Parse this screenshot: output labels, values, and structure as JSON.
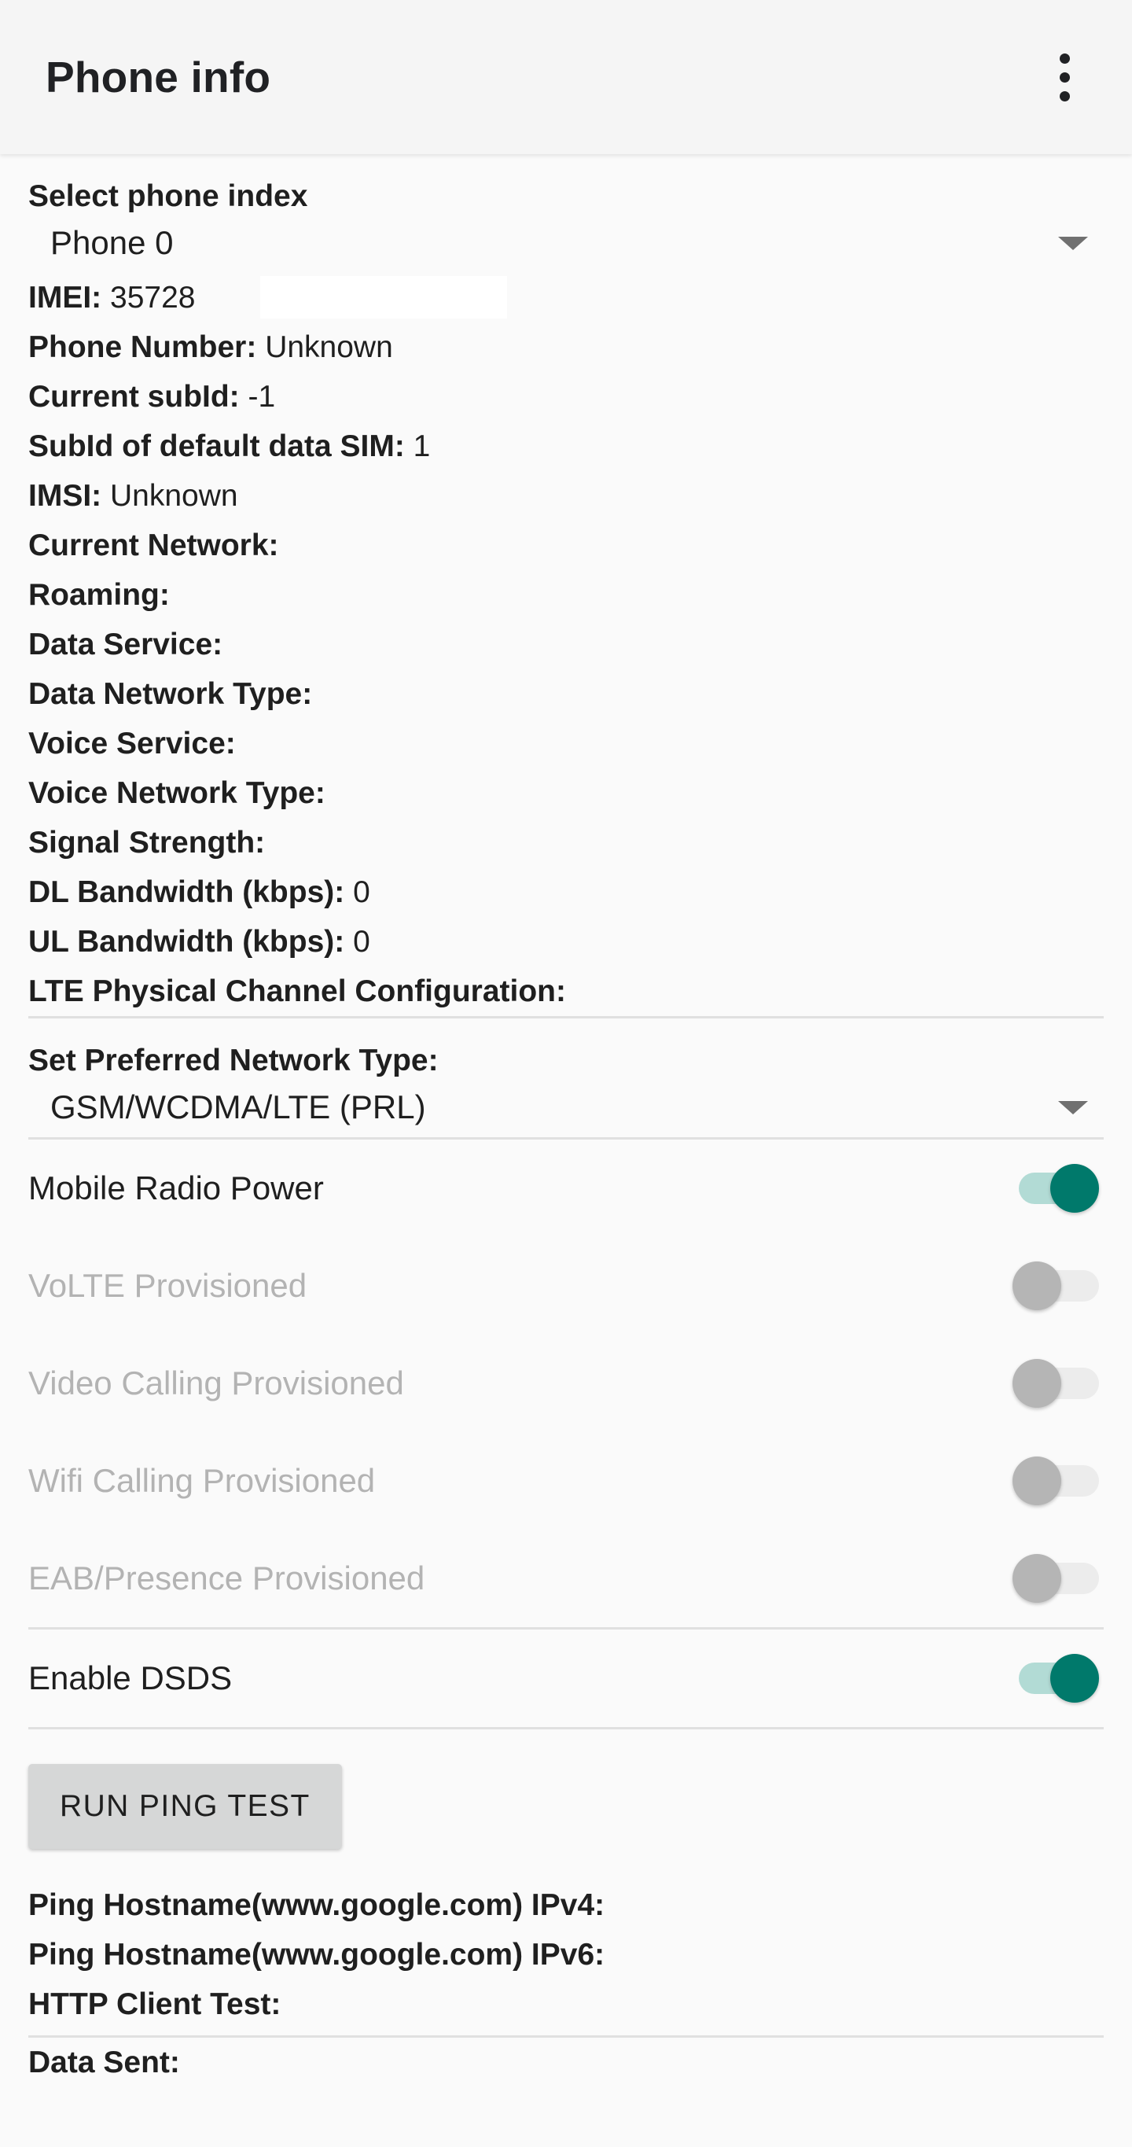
{
  "app": {
    "title": "Phone info",
    "overflow_icon": "more-vert-icon"
  },
  "phone_index": {
    "label": "Select phone index",
    "selected": "Phone 0",
    "caret_icon": "chevron-down-icon"
  },
  "info": [
    {
      "key": "IMEI:",
      "value": "35728",
      "redacted": true
    },
    {
      "key": "Phone Number:",
      "value": "Unknown"
    },
    {
      "key": "Current subId:",
      "value": "-1"
    },
    {
      "key": "SubId of default data SIM:",
      "value": "1"
    },
    {
      "key": "IMSI:",
      "value": "Unknown"
    },
    {
      "key": "Current Network:",
      "value": ""
    },
    {
      "key": "Roaming:",
      "value": ""
    },
    {
      "key": "Data Service:",
      "value": ""
    },
    {
      "key": "Data Network Type:",
      "value": ""
    },
    {
      "key": "Voice Service:",
      "value": ""
    },
    {
      "key": "Voice Network Type:",
      "value": ""
    },
    {
      "key": "Signal Strength:",
      "value": ""
    },
    {
      "key": "DL Bandwidth (kbps):",
      "value": "0"
    },
    {
      "key": "UL Bandwidth (kbps):",
      "value": "0"
    },
    {
      "key": "LTE Physical Channel Configuration:",
      "value": ""
    }
  ],
  "preferred_network": {
    "label": "Set Preferred Network Type:",
    "selected": "GSM/WCDMA/LTE (PRL)",
    "caret_icon": "chevron-down-icon"
  },
  "switches": [
    {
      "label": "Mobile Radio Power",
      "state": "on",
      "disabled": false
    },
    {
      "label": "VoLTE Provisioned",
      "state": "off",
      "disabled": true
    },
    {
      "label": "Video Calling Provisioned",
      "state": "off",
      "disabled": true
    },
    {
      "label": "Wifi Calling Provisioned",
      "state": "off",
      "disabled": true
    },
    {
      "label": "EAB/Presence Provisioned",
      "state": "off",
      "disabled": true
    },
    {
      "label": "Enable DSDS",
      "state": "on",
      "disabled": false
    }
  ],
  "ping": {
    "button_label": "RUN PING TEST",
    "rows": [
      "Ping Hostname(www.google.com) IPv4:",
      "Ping Hostname(www.google.com) IPv6:",
      "HTTP Client Test:"
    ]
  },
  "tail": [
    "Data Sent:"
  ],
  "colors": {
    "accent_on": "#00796b",
    "track_on": "#b2dbd5",
    "thumb_off": "#b5b5b5",
    "track_off": "#ececec",
    "appbar_bg": "#f5f5f5",
    "page_bg": "#fafafa",
    "divider": "#e0e0e0",
    "text": "#1f1f1f",
    "text_disabled": "#b3b3b3",
    "button_bg": "#d6d7d7"
  }
}
